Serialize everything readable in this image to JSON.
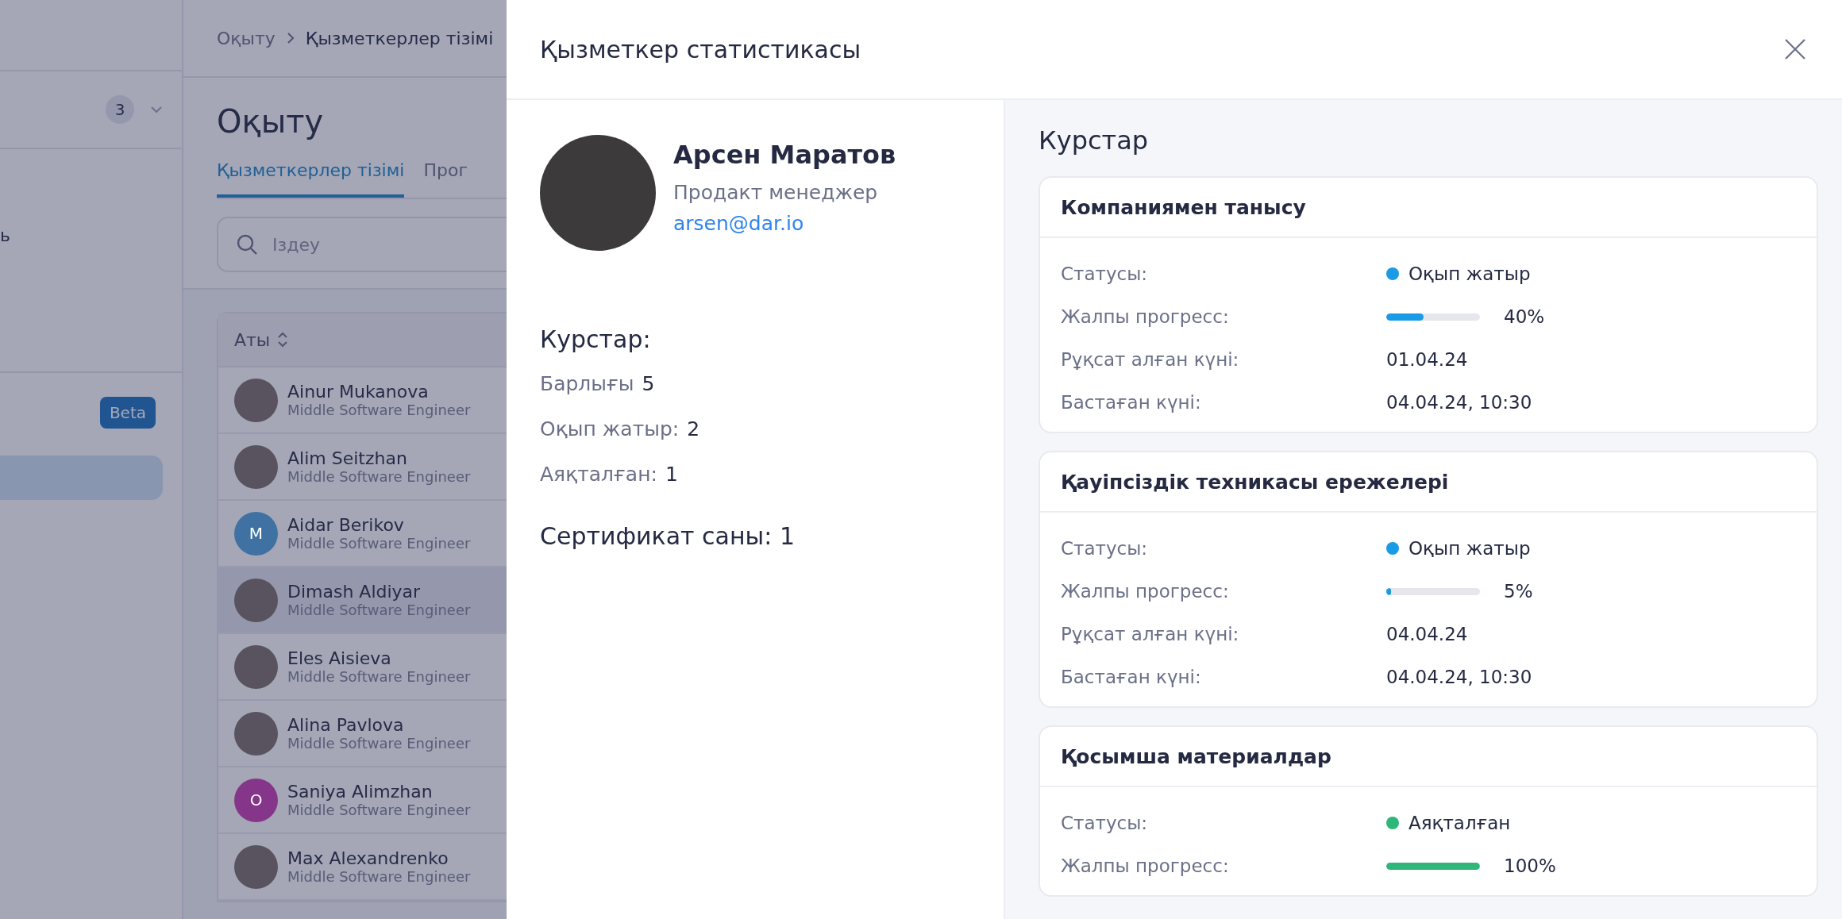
{
  "sidebar": {
    "count_badge": "3",
    "fragment_text": "ь",
    "beta_badge": "Beta",
    "items": [
      {
        "selected": true
      }
    ]
  },
  "main": {
    "breadcrumb": [
      "Оқыту",
      "Қызметкерлер тізімі"
    ],
    "title": "Оқыту",
    "tabs": [
      {
        "label": "Қызметкерлер тізімі",
        "selected": true
      },
      {
        "label": "Прог",
        "selected": false
      }
    ],
    "search": {
      "placeholder": "Іздеу"
    },
    "table": {
      "columns": [
        "Аты"
      ],
      "rows": [
        {
          "name": "Ainur Mukanova",
          "role": "Middle Software Engineer",
          "avatar": {
            "kind": "photo"
          },
          "selected": false
        },
        {
          "name": "Alim Seitzhan",
          "role": "Middle Software Engineer",
          "avatar": {
            "kind": "photo"
          },
          "selected": false
        },
        {
          "name": "Aidar Berikov",
          "role": "Middle Software Engineer",
          "avatar": {
            "kind": "initial",
            "letter": "M",
            "color": "#3f72a3"
          },
          "selected": false
        },
        {
          "name": "Dimash Aldiyar",
          "role": "Middle Software Engineer",
          "avatar": {
            "kind": "photo"
          },
          "selected": true
        },
        {
          "name": "Eles Aisieva",
          "role": "Middle Software Engineer",
          "avatar": {
            "kind": "photo"
          },
          "selected": false
        },
        {
          "name": "Alina Pavlova",
          "role": "Middle Software Engineer",
          "avatar": {
            "kind": "photo"
          },
          "selected": false
        },
        {
          "name": "Saniya Alimzhan",
          "role": "Middle Software Engineer",
          "avatar": {
            "kind": "initial",
            "letter": "O",
            "color": "#86368a"
          },
          "selected": false
        },
        {
          "name": "Max Alexandrenko",
          "role": "Middle Software Engineer",
          "avatar": {
            "kind": "photo"
          },
          "selected": false
        }
      ]
    }
  },
  "drawer": {
    "title": "Қызметкер статистикасы",
    "profile": {
      "name": "Арсен Маратов",
      "position": "Продакт менеджер",
      "email": "arsen@dar.io"
    },
    "summary": {
      "heading": "Курстар:",
      "stats": [
        {
          "label": "Барлығы",
          "value": "5"
        },
        {
          "label": "Оқып жатыр:",
          "value": "2"
        },
        {
          "label": "Аяқталған:",
          "value": "1"
        }
      ],
      "certificates": "Сертификат саны: 1"
    },
    "courses_heading": "Курстар",
    "courses": [
      {
        "title": "Компаниямен танысу",
        "status_label": "Статусы:",
        "status": "Оқып жатыр",
        "color": "#1a9be6",
        "progress_label": "Жалпы прогресс:",
        "level": 0.4,
        "progress": "40%",
        "rows": [
          {
            "label": "Рұқсат алған күні:",
            "value": "01.04.24"
          },
          {
            "label": "Бастаған күні:",
            "value": "04.04.24, 10:30"
          }
        ]
      },
      {
        "title": "Қауіпсіздік техникасы ережелері",
        "status_label": "Статусы:",
        "status": "Оқып жатыр",
        "color": "#1a9be6",
        "progress_label": "Жалпы прогресс:",
        "level": 0.05,
        "progress": "5%",
        "rows": [
          {
            "label": "Рұқсат алған күні:",
            "value": "04.04.24"
          },
          {
            "label": "Бастаған күні:",
            "value": "04.04.24, 10:30"
          }
        ]
      },
      {
        "title": "Қосымша материалдар",
        "status_label": "Статусы:",
        "status": "Аяқталған",
        "color": "#2fb77a",
        "progress_label": "Жалпы прогресс:",
        "level": 1,
        "progress": "100%"
      }
    ]
  }
}
